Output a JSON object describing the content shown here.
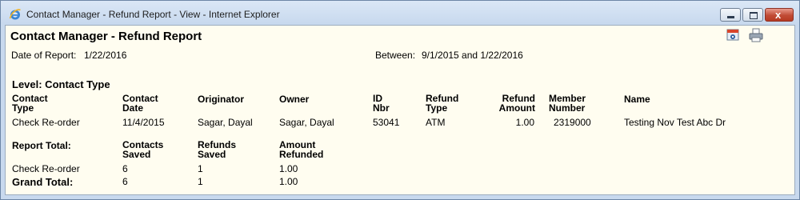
{
  "window": {
    "title": "Contact Manager - Refund Report - View - Internet Explorer",
    "close_glyph": "x"
  },
  "report": {
    "title": "Contact Manager - Refund Report",
    "date_label": "Date of Report:",
    "date_value": "1/22/2016",
    "between_label": "Between:",
    "between_value": "9/1/2015 and 1/22/2016",
    "level_heading": "Level: Contact Type",
    "columns": {
      "contact_type": [
        "Contact",
        "Type"
      ],
      "contact_date": [
        "Contact",
        "Date"
      ],
      "originator": "Originator",
      "owner": "Owner",
      "id_nbr": [
        "ID",
        "Nbr"
      ],
      "refund_type": [
        "Refund",
        "Type"
      ],
      "refund_amount": [
        "Refund",
        "Amount"
      ],
      "member_number": [
        "Member",
        "Number"
      ],
      "name": "Name"
    },
    "rows": [
      {
        "contact_type": "Check Re-order",
        "contact_date": "11/4/2015",
        "originator": "Sagar, Dayal",
        "owner": "Sagar, Dayal",
        "id_nbr": "53041",
        "refund_type": "ATM",
        "refund_amount": "1.00",
        "member_number": "2319000",
        "name": "Testing Nov Test Abc Dr"
      }
    ],
    "report_total": {
      "label": "Report Total:",
      "columns": {
        "contacts_saved": [
          "Contacts",
          "Saved"
        ],
        "refunds_saved": [
          "Refunds",
          "Saved"
        ],
        "amount_refunded": [
          "Amount",
          "Refunded"
        ]
      },
      "rows": [
        {
          "type": "Check Re-order",
          "contacts_saved": "6",
          "refunds_saved": "1",
          "amount_refunded": "1.00"
        }
      ]
    },
    "grand_total": {
      "label": "Grand Total:",
      "contacts_saved": "6",
      "refunds_saved": "1",
      "amount_refunded": "1.00"
    }
  },
  "toolbar": {
    "icons": [
      "preview-icon",
      "print-icon"
    ]
  },
  "colors": {
    "content_bg": "#fffdf0",
    "close_button": "#c14b35",
    "window_frame": "#c9d9ec"
  }
}
